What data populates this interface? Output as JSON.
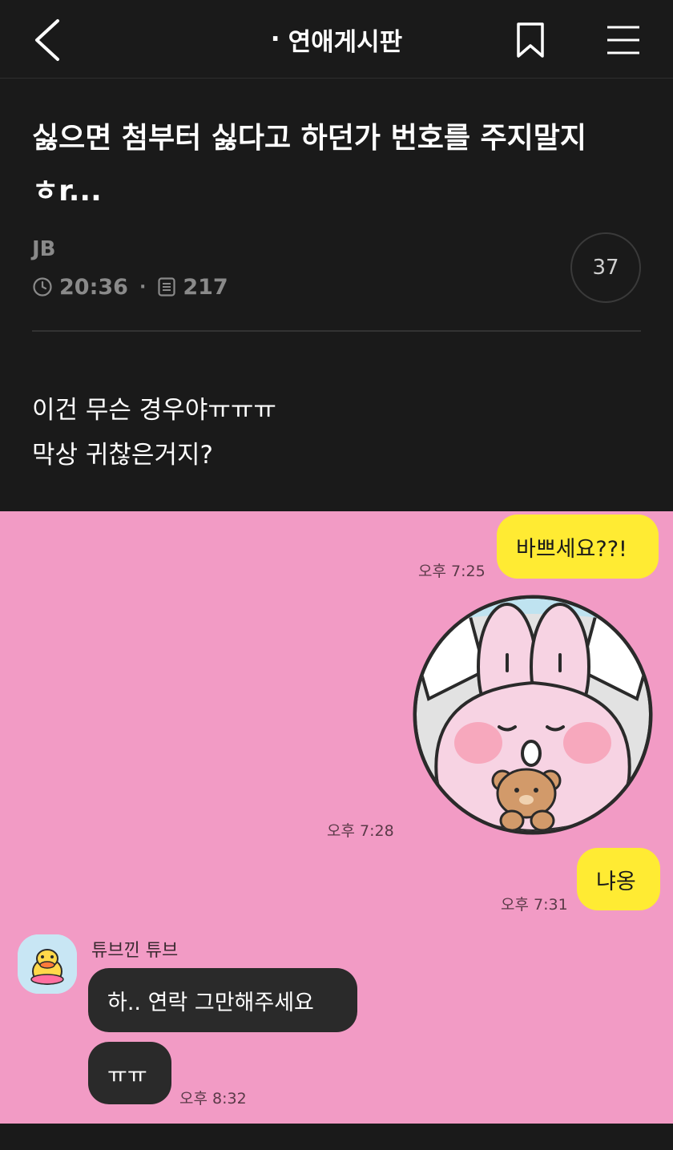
{
  "topbar": {
    "board_dot": "·",
    "board_name": "연애게시판",
    "icons": [
      "back-arrow-icon",
      "bookmark-icon",
      "hamburger-menu-icon"
    ]
  },
  "post": {
    "title": "싫으면 첨부터 싫다고 하던가 번호를 주지말지 ㅎr...",
    "author": "JB",
    "time": "20:36",
    "meta_separator": "·",
    "views": "217",
    "comment_count": "37",
    "body_lines": [
      "이건 무슨 경우야ㅠㅠㅠ",
      "막상 귀찮은거지?"
    ]
  },
  "chat": {
    "background": "#f29bc5",
    "messages": [
      {
        "from": "me",
        "text": "바쁘세요??!",
        "time": "오후 7:25"
      },
      {
        "from": "me",
        "type": "sticker",
        "sticker": "pink-bunny-holding-bear-sticker",
        "time": "오후 7:28"
      },
      {
        "from": "me",
        "text": "냐옹",
        "time": "오후 7:31"
      },
      {
        "from": "them",
        "sender": "튜브낀 튜브",
        "text": "하.. 연락 그만해주세요"
      },
      {
        "from": "them",
        "text": "ㅠㅠ",
        "time": "오후 8:32"
      }
    ]
  },
  "colors": {
    "app_background": "#1a1a1a",
    "my_bubble": "#ffeb33",
    "their_bubble": "#2a2a2a",
    "meta_gray": "#8a8a8a"
  }
}
